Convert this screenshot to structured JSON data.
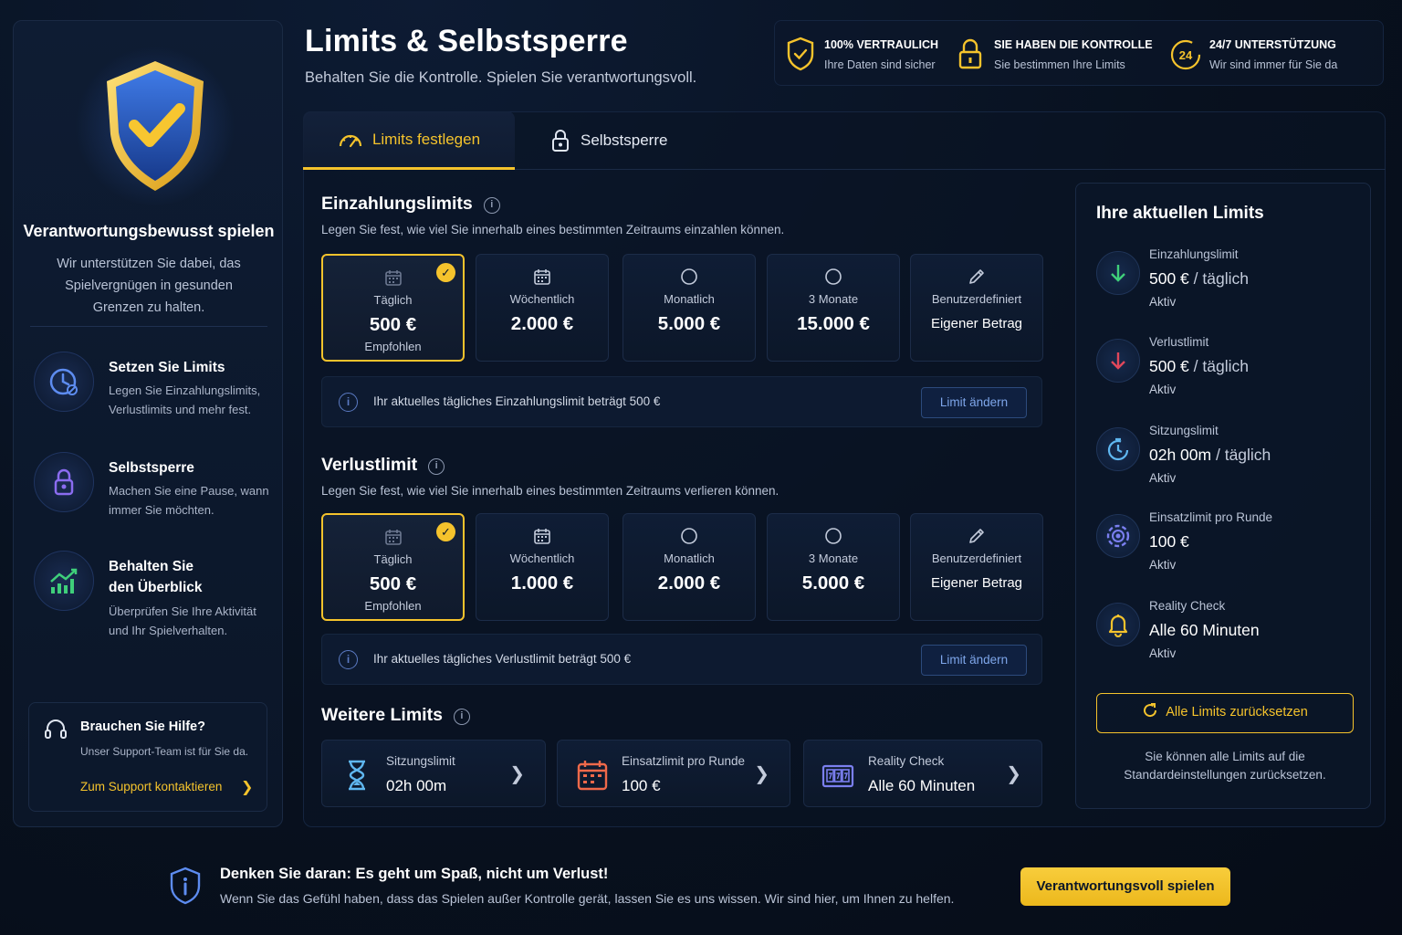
{
  "colors": {
    "accent": "#f5c32c",
    "background": "#08111f",
    "panel": "#0c1729",
    "link_blue": "#7ea6ea",
    "green": "#3fcf7a",
    "red": "#e0475b"
  },
  "sidebar": {
    "title": "Verantwortungsbewusst spielen",
    "subtitle": "Wir unterstützen Sie dabei, das Spielvergnügen in gesunden Grenzen zu halten.",
    "features": [
      {
        "icon": "clock-limit-icon",
        "title": "Setzen Sie Limits",
        "desc": "Legen Sie Einzahlungslimits, Verlustlimits und mehr fest."
      },
      {
        "icon": "lock-icon",
        "title": "Selbstsperre",
        "desc": "Machen Sie eine Pause, wann immer Sie möchten."
      },
      {
        "icon": "chart-icon",
        "title_line1": "Behalten Sie",
        "title_line2": "den Überblick",
        "desc": "Überprüfen Sie Ihre Aktivität und Ihr Spielverhalten."
      }
    ],
    "help": {
      "title": "Brauchen Sie Hilfe?",
      "desc": "Unser Support-Team ist für Sie da.",
      "link": "Zum Support kontaktieren"
    }
  },
  "header": {
    "title": "Limits & Selbstsperre",
    "subtitle": "Behalten Sie die Kontrolle. Spielen Sie verantwortungsvoll.",
    "trust": [
      {
        "title": "100% VERTRAULICH",
        "desc": "Ihre Daten sind sicher"
      },
      {
        "title": "SIE HABEN DIE KONTROLLE",
        "desc": "Sie bestimmen Ihre Limits"
      },
      {
        "badge": "24",
        "title": "24/7 UNTERSTÜTZUNG",
        "desc": "Wir sind immer für Sie da"
      }
    ]
  },
  "tabs": [
    {
      "label": "Limits festlegen",
      "active": true
    },
    {
      "label": "Selbstsperre",
      "active": false
    }
  ],
  "deposit": {
    "title": "Einzahlungslimits",
    "desc": "Legen Sie fest, wie viel Sie innerhalb eines bestimmten Zeitraums einzahlen können.",
    "options": [
      {
        "label": "Täglich",
        "value": "500 €",
        "note": "Empfohlen",
        "selected": true
      },
      {
        "label": "Wöchentlich",
        "value": "2.000 €"
      },
      {
        "label": "Monatlich",
        "value": "5.000 €"
      },
      {
        "label": "3 Monate",
        "value": "15.000 €"
      },
      {
        "label": "Benutzerdefiniert",
        "value": "Eigener Betrag"
      }
    ],
    "notice": "Ihr aktuelles tägliches Einzahlungslimit beträgt 500 €",
    "button": "Limit ändern"
  },
  "loss": {
    "title": "Verlustlimit",
    "desc": "Legen Sie fest, wie viel Sie innerhalb eines bestimmten Zeitraums verlieren können.",
    "options": [
      {
        "label": "Täglich",
        "value": "500 €",
        "note": "Empfohlen",
        "selected": true
      },
      {
        "label": "Wöchentlich",
        "value": "1.000 €"
      },
      {
        "label": "Monatlich",
        "value": "2.000 €"
      },
      {
        "label": "3 Monate",
        "value": "5.000 €"
      },
      {
        "label": "Benutzerdefiniert",
        "value": "Eigener Betrag"
      }
    ],
    "notice": "Ihr aktuelles tägliches Verlustlimit beträgt 500 €",
    "button": "Limit ändern"
  },
  "more": {
    "title": "Weitere Limits",
    "items": [
      {
        "icon": "hourglass-icon",
        "label": "Sitzungslimit",
        "value": "02h 00m"
      },
      {
        "icon": "calendar-icon",
        "label": "Einsatzlimit pro Runde",
        "value": "100 €"
      },
      {
        "icon": "slot-machine-icon",
        "label": "Reality Check",
        "value": "Alle 60 Minuten"
      }
    ]
  },
  "current": {
    "title": "Ihre aktuellen Limits",
    "items": [
      {
        "label": "Einzahlungslimit",
        "value": "500 €",
        "period": "/ täglich",
        "status": "Aktiv"
      },
      {
        "label": "Verlustlimit",
        "value": "500 €",
        "period": "/ täglich",
        "status": "Aktiv"
      },
      {
        "label": "Sitzungslimit",
        "value": "02h 00m",
        "period": "/ täglich",
        "status": "Aktiv"
      },
      {
        "label": "Einsatzlimit pro Runde",
        "value": "100 €",
        "period": "",
        "status": "Aktiv"
      },
      {
        "label": "Reality Check",
        "value": "Alle 60 Minuten",
        "period": "",
        "status": "Aktiv"
      }
    ],
    "reset_button": "Alle Limits zurücksetzen",
    "reset_note": "Sie können alle Limits auf die Standardeinstellungen zurücksetzen."
  },
  "footer": {
    "title": "Denken Sie daran: Es geht um Spaß, nicht um Verlust!",
    "desc": "Wenn Sie das Gefühl haben, dass das Spielen außer Kontrolle gerät, lassen Sie es uns wissen. Wir sind hier, um Ihnen zu helfen.",
    "button": "Verantwortungsvoll spielen"
  }
}
